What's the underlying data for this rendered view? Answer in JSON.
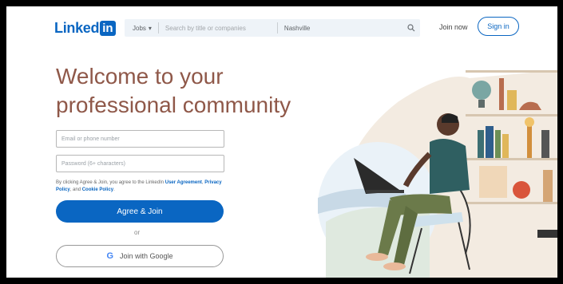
{
  "header": {
    "logo_text": "Linked",
    "logo_box": "in",
    "search": {
      "category": "Jobs",
      "keyword_placeholder": "Search by title or companies",
      "location": "Nashville"
    },
    "join_now": "Join now",
    "sign_in": "Sign in"
  },
  "hero": {
    "headline_line1": "Welcome to your",
    "headline_line2": "professional community",
    "email_placeholder": "Email or phone number",
    "password_placeholder": "Password (6+ characters)",
    "terms_prefix": "By clicking Agree & Join, you agree to the LinkedIn",
    "terms_user_agreement": "User Agreement",
    "terms_privacy": "Privacy Policy",
    "terms_and": "and",
    "terms_cookie": "Cookie Policy",
    "agree_button": "Agree & Join",
    "or_text": "or",
    "google_button": "Join with Google"
  },
  "colors": {
    "brand": "#0a66c2",
    "headline": "#8f5849"
  }
}
